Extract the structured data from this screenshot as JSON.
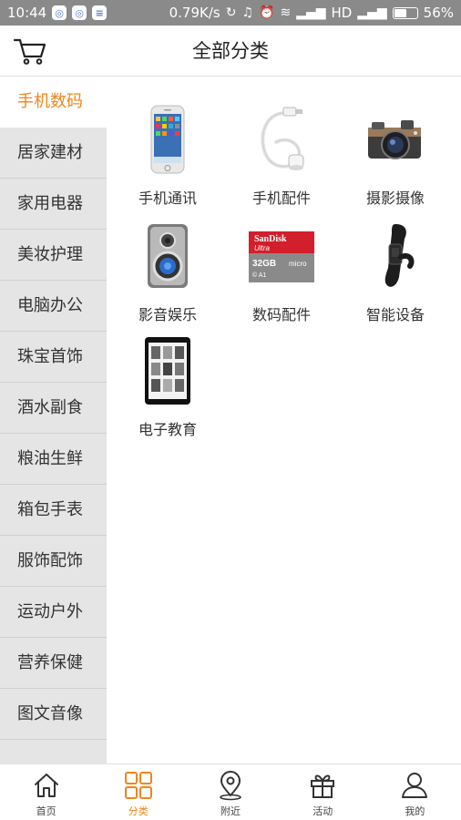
{
  "status_bar": {
    "time": "10:44",
    "speed": "0.79K/s",
    "network": "HD",
    "battery": "56%",
    "battery_level": 0.56
  },
  "header": {
    "title": "全部分类"
  },
  "sidebar": {
    "items": [
      {
        "label": "手机数码",
        "active": true
      },
      {
        "label": "居家建材",
        "active": false
      },
      {
        "label": "家用电器",
        "active": false
      },
      {
        "label": "美妆护理",
        "active": false
      },
      {
        "label": "电脑办公",
        "active": false
      },
      {
        "label": "珠宝首饰",
        "active": false
      },
      {
        "label": "酒水副食",
        "active": false
      },
      {
        "label": "粮油生鲜",
        "active": false
      },
      {
        "label": "箱包手表",
        "active": false
      },
      {
        "label": "服饰配饰",
        "active": false
      },
      {
        "label": "运动户外",
        "active": false
      },
      {
        "label": "营养保健",
        "active": false
      },
      {
        "label": "图文音像",
        "active": false
      }
    ]
  },
  "categories": [
    {
      "label": "手机通讯",
      "icon": "smartphone-icon"
    },
    {
      "label": "手机配件",
      "icon": "charging-cable-icon"
    },
    {
      "label": "摄影摄像",
      "icon": "camera-icon"
    },
    {
      "label": "影音娱乐",
      "icon": "speaker-icon"
    },
    {
      "label": "数码配件",
      "icon": "memory-card-icon",
      "brand_text": "SanDisk",
      "sub_text": "Ultra",
      "capacity": "32GB"
    },
    {
      "label": "智能设备",
      "icon": "smart-band-icon"
    },
    {
      "label": "电子教育",
      "icon": "ereader-icon"
    }
  ],
  "bottom_nav": [
    {
      "label": "首页",
      "icon": "home-icon",
      "active": false
    },
    {
      "label": "分类",
      "icon": "grid-icon",
      "active": true
    },
    {
      "label": "附近",
      "icon": "location-icon",
      "active": false
    },
    {
      "label": "活动",
      "icon": "gift-icon",
      "active": false
    },
    {
      "label": "我的",
      "icon": "user-icon",
      "active": false
    }
  ],
  "colors": {
    "accent": "#f08519",
    "sidebar_bg": "#e5e5e5",
    "status_bar_bg": "#8a8a8a"
  }
}
